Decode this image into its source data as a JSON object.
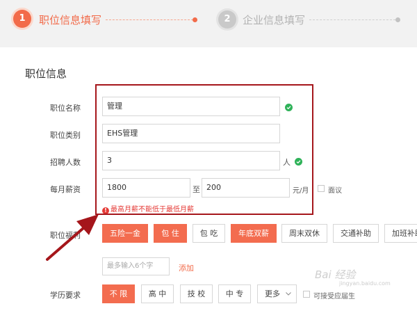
{
  "stepper": {
    "step1_number": "1",
    "step1_label": "职位信息填写",
    "step2_number": "2",
    "step2_label": "企业信息填写"
  },
  "section_title": "职位信息",
  "fields": {
    "job_name": {
      "label": "职位名称",
      "value": "管理"
    },
    "job_category": {
      "label": "职位类别",
      "value": "EHS管理"
    },
    "headcount": {
      "label": "招聘人数",
      "value": "3",
      "unit": "人"
    },
    "salary": {
      "label": "每月薪资",
      "min": "1800",
      "to": "至",
      "max": "200",
      "unit": "元/月",
      "negotiable": "面议",
      "error": "最高月薪不能低于最低月薪"
    }
  },
  "benefits": {
    "label": "职位福利",
    "items": [
      {
        "label": "五险一金",
        "selected": true
      },
      {
        "label": "包 住",
        "selected": true
      },
      {
        "label": "包 吃",
        "selected": false
      },
      {
        "label": "年底双薪",
        "selected": true
      },
      {
        "label": "周末双休",
        "selected": false
      },
      {
        "label": "交通补助",
        "selected": false
      },
      {
        "label": "加班补助",
        "selected": false
      }
    ],
    "custom_placeholder": "最多输入6个字",
    "add_label": "添加"
  },
  "education": {
    "label": "学历要求",
    "items": [
      {
        "label": "不 限",
        "selected": true
      },
      {
        "label": "高 中",
        "selected": false
      },
      {
        "label": "技 校",
        "selected": false
      },
      {
        "label": "中 专",
        "selected": false
      }
    ],
    "more_label": "更多",
    "fresh_grad_label": "可接受应届生"
  },
  "watermark": {
    "main": "Bai 经验",
    "sub": "jingyan.baidu.com"
  },
  "colors": {
    "accent": "#f26b4a",
    "success": "#2fb259",
    "error": "#e53935",
    "highlight": "#a5161b"
  }
}
